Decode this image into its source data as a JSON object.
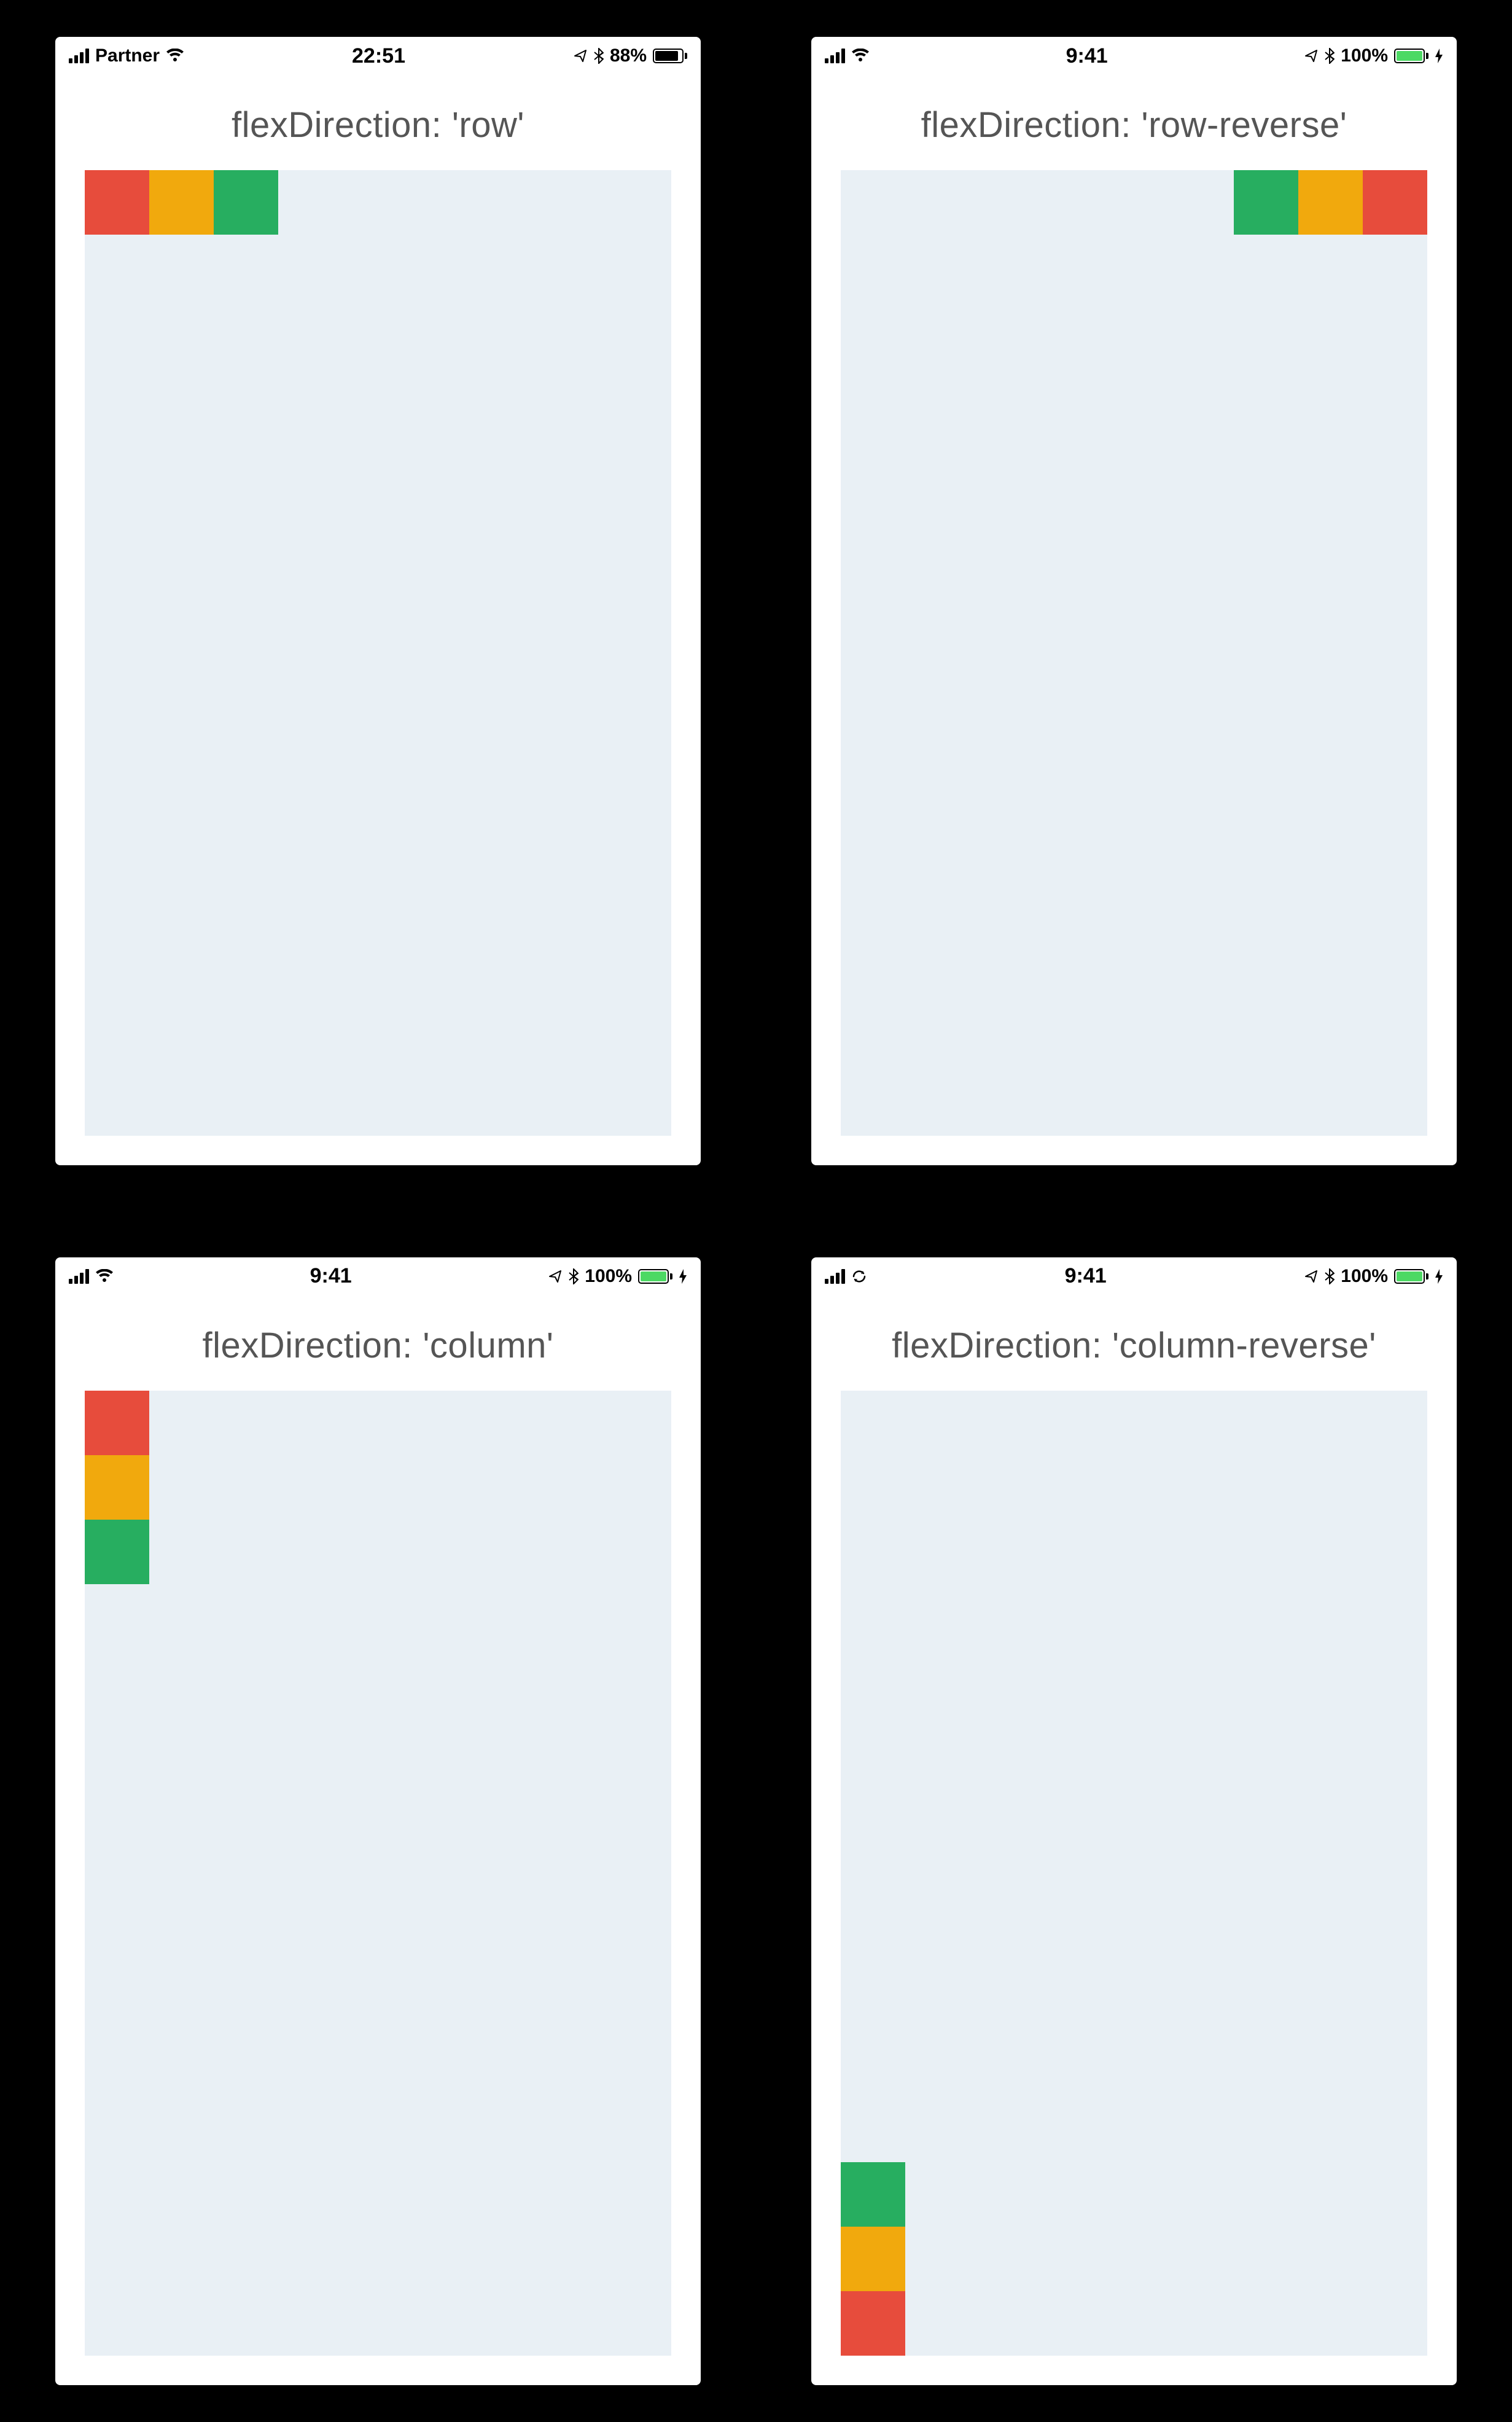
{
  "colors": {
    "red": "#e74c3c",
    "orange": "#f1a90d",
    "green": "#27ae60",
    "battery_green": "#4cd964",
    "container_bg": "#e9f0f5"
  },
  "screens": [
    {
      "title": "flexDirection: 'row'",
      "flex_direction": "row",
      "status": {
        "carrier": "Partner",
        "show_wifi": true,
        "show_sync": false,
        "time": "22:51",
        "show_location": true,
        "show_bluetooth": true,
        "battery_pct": "88%",
        "battery_fill_pct": 88,
        "battery_color": "#000000",
        "show_bolt": false
      },
      "boxes": [
        "red",
        "orange",
        "green"
      ]
    },
    {
      "title": "flexDirection: 'row-reverse'",
      "flex_direction": "row-reverse",
      "status": {
        "carrier": "",
        "show_wifi": true,
        "show_sync": false,
        "time": "9:41",
        "show_location": true,
        "show_bluetooth": true,
        "battery_pct": "100%",
        "battery_fill_pct": 100,
        "battery_color": "#4cd964",
        "show_bolt": true
      },
      "boxes": [
        "red",
        "orange",
        "green"
      ]
    },
    {
      "title": "flexDirection: 'column'",
      "flex_direction": "column",
      "status": {
        "carrier": "",
        "show_wifi": true,
        "show_sync": false,
        "time": "9:41",
        "show_location": true,
        "show_bluetooth": true,
        "battery_pct": "100%",
        "battery_fill_pct": 100,
        "battery_color": "#4cd964",
        "show_bolt": true
      },
      "boxes": [
        "red",
        "orange",
        "green"
      ]
    },
    {
      "title": "flexDirection: 'column-reverse'",
      "flex_direction": "column-reverse",
      "status": {
        "carrier": "",
        "show_wifi": false,
        "show_sync": true,
        "time": "9:41",
        "show_location": true,
        "show_bluetooth": true,
        "battery_pct": "100%",
        "battery_fill_pct": 100,
        "battery_color": "#4cd964",
        "show_bolt": true
      },
      "boxes": [
        "red",
        "orange",
        "green"
      ]
    }
  ]
}
